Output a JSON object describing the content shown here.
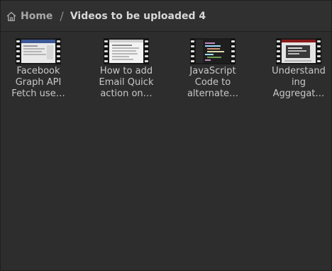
{
  "breadcrumb": {
    "home_icon": "home-icon",
    "home_label": "Home",
    "separator": "/",
    "current": "Videos to be uploaded 4"
  },
  "files": [
    {
      "name_lines": [
        "Facebook",
        "Graph API",
        "Fetch use…"
      ],
      "thumb_style": "light-webpage"
    },
    {
      "name_lines": [
        "How to add",
        "Email Quick",
        "action on…"
      ],
      "thumb_style": "light-document"
    },
    {
      "name_lines": [
        "JavaScript",
        "Code to",
        "alternate…"
      ],
      "thumb_style": "dark-code-editor"
    },
    {
      "name_lines": [
        "Understand",
        "ing",
        "Aggregat…"
      ],
      "thumb_style": "light-dialog"
    }
  ],
  "colors": {
    "background": "#2d2d2d",
    "pathbar": "#303030",
    "text": "#c8c8c8"
  }
}
